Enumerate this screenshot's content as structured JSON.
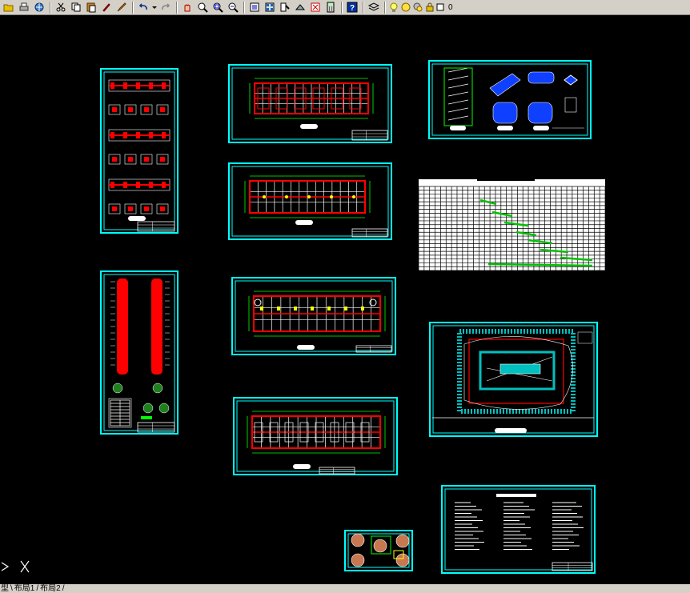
{
  "toolbar": {
    "buttons": [
      {
        "name": "open-icon"
      },
      {
        "name": "plot-icon"
      },
      {
        "name": "publish-icon"
      },
      {
        "name": "cut-icon"
      },
      {
        "name": "copy-icon"
      },
      {
        "name": "paste-icon"
      },
      {
        "name": "matchprop-icon"
      },
      {
        "name": "brush-icon"
      },
      {
        "name": "undo-icon"
      },
      {
        "name": "redo-icon"
      },
      {
        "name": "pan-icon"
      },
      {
        "name": "zoom-realtime-icon"
      },
      {
        "name": "zoom-window-icon"
      },
      {
        "name": "zoom-previous-icon"
      },
      {
        "name": "properties-icon"
      },
      {
        "name": "design-center-icon"
      },
      {
        "name": "tool-palettes-icon"
      },
      {
        "name": "sheet-set-icon"
      },
      {
        "name": "markup-icon"
      },
      {
        "name": "calculator-icon"
      },
      {
        "name": "help-icon"
      },
      {
        "name": "layer-manager-icon"
      }
    ],
    "layer": {
      "value": "0"
    }
  },
  "tabs": {
    "model": "型",
    "sep1": "\\",
    "layout1": "布局1",
    "sep2": "/",
    "layout2": "布局2",
    "sep3": "/"
  },
  "colors": {
    "background": "#000000",
    "frame": "#00ffff",
    "drawing": "#ffffff",
    "accent_red": "#ff0000",
    "accent_green": "#00ff00",
    "accent_yellow": "#ffff00",
    "toolbar": "#d4d0c8"
  },
  "sheets": [
    {
      "name": "sheet-foundation-details"
    },
    {
      "name": "sheet-floor-plan-1"
    },
    {
      "name": "sheet-stair-details"
    },
    {
      "name": "sheet-floor-plan-2"
    },
    {
      "name": "sheet-schedule-table"
    },
    {
      "name": "sheet-elevation-sections"
    },
    {
      "name": "sheet-floor-plan-3"
    },
    {
      "name": "sheet-site-plan"
    },
    {
      "name": "sheet-floor-plan-4"
    },
    {
      "name": "sheet-notes"
    },
    {
      "name": "sheet-small-details"
    }
  ]
}
